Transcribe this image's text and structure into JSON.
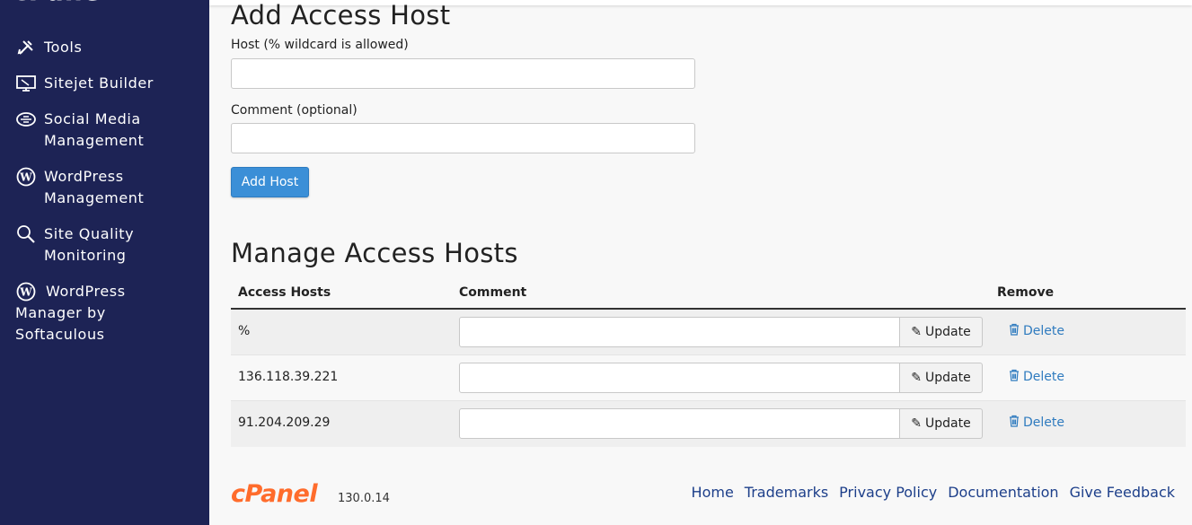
{
  "sidebar": {
    "logo_text": "cPanel",
    "items": [
      {
        "label": "Tools",
        "icon": "tools-icon"
      },
      {
        "label": "Sitejet Builder",
        "icon": "monitor-icon"
      },
      {
        "label": "Social Media\nManagement",
        "icon": "social-media-icon"
      },
      {
        "label": "WordPress\nManagement",
        "icon": "wordpress-icon"
      },
      {
        "label": "Site Quality\nMonitoring",
        "icon": "magnifier-icon"
      },
      {
        "label": "WordPress\n  Manager by\nSoftaculous",
        "icon": "wordpress-icon"
      }
    ]
  },
  "add_host": {
    "title": "Add Access Host",
    "host_label": "Host (% wildcard is allowed)",
    "host_value": "",
    "comment_label": "Comment (optional)",
    "comment_value": "",
    "submit_label": "Add Host"
  },
  "manage": {
    "title": "Manage Access Hosts",
    "columns": [
      "Access Hosts",
      "Comment",
      "Remove"
    ],
    "rows": [
      {
        "host": "%",
        "comment": "",
        "update_label": "Update",
        "delete_label": "Delete"
      },
      {
        "host": "136.118.39.221",
        "comment": "",
        "update_label": "Update",
        "delete_label": "Delete"
      },
      {
        "host": "91.204.209.29",
        "comment": "",
        "update_label": "Update",
        "delete_label": "Delete"
      }
    ]
  },
  "footer": {
    "logo_text": "cPanel",
    "version": "130.0.14",
    "links": [
      "Home",
      "Trademarks",
      "Privacy Policy",
      "Documentation",
      "Give Feedback"
    ]
  },
  "colors": {
    "sidebar_bg": "#1d2355",
    "primary_button": "#3b8fd7",
    "delete_link": "#2f7bbf",
    "brand_orange": "#ff6c2c"
  }
}
